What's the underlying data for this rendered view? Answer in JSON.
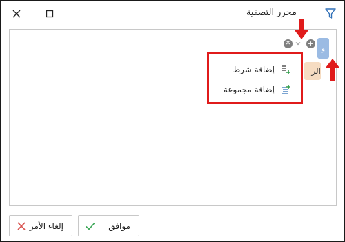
{
  "window": {
    "title": "محرر التصفية",
    "icons": {
      "filter": "filter-icon",
      "close": "close-icon",
      "maximize": "maximize-icon"
    }
  },
  "editor": {
    "group_chip_label": "و",
    "condition_chip_label": "الر",
    "add_icon": "plus-circle-icon",
    "remove_icon": "x-circle-icon",
    "dropdown_icon": "chevron-down-icon"
  },
  "context_menu": {
    "items": [
      {
        "label": "إضافة شرط",
        "icon": "add-condition-icon"
      },
      {
        "label": "إضافة مجموعة",
        "icon": "add-group-icon"
      }
    ],
    "highlight_color": "#e01b1b"
  },
  "annotations": {
    "arrow_color": "#e01b1b"
  },
  "footer": {
    "ok_label": "موافق",
    "cancel_label": "إلغاء الأمر"
  },
  "colors": {
    "group_chip": "#9bbbe3",
    "condition_chip": "#f6dcc2",
    "ok_check": "#3aa655",
    "cancel_x": "#d9534f"
  }
}
